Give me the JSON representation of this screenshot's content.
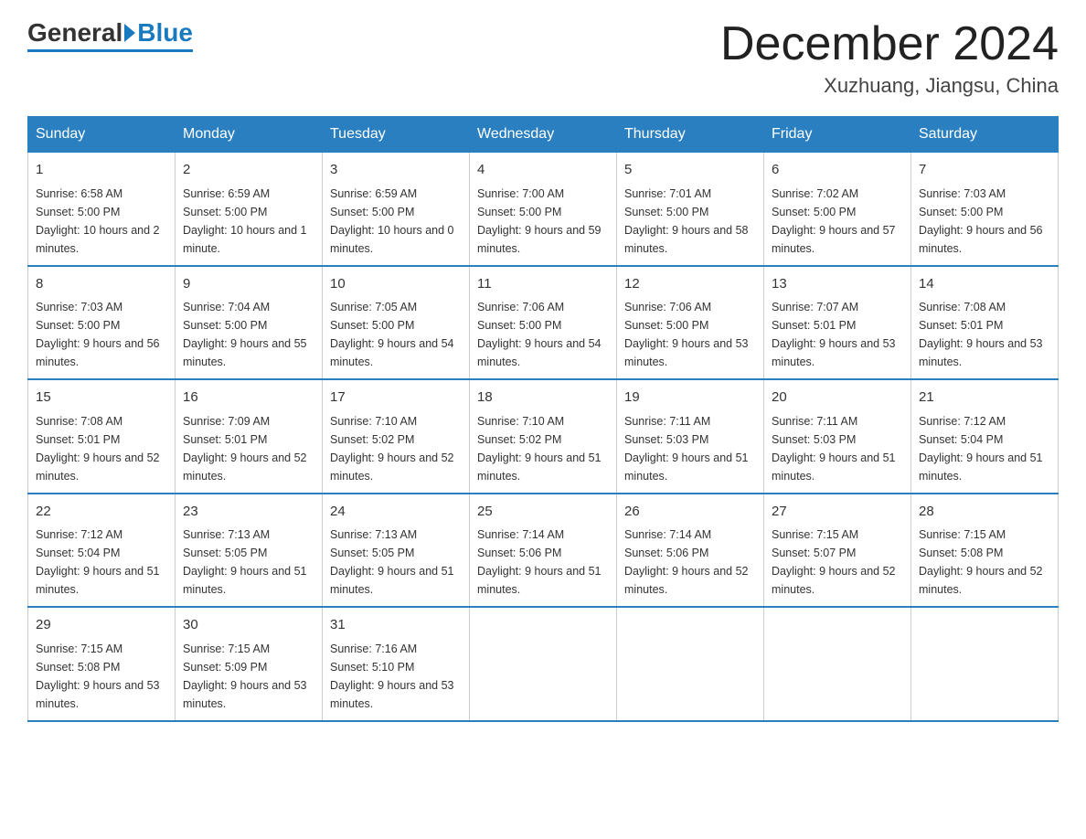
{
  "logo": {
    "general": "General",
    "blue": "Blue"
  },
  "header": {
    "month": "December 2024",
    "location": "Xuzhuang, Jiangsu, China"
  },
  "days_of_week": [
    "Sunday",
    "Monday",
    "Tuesday",
    "Wednesday",
    "Thursday",
    "Friday",
    "Saturday"
  ],
  "weeks": [
    [
      {
        "day": "1",
        "sunrise": "6:58 AM",
        "sunset": "5:00 PM",
        "daylight": "10 hours and 2 minutes."
      },
      {
        "day": "2",
        "sunrise": "6:59 AM",
        "sunset": "5:00 PM",
        "daylight": "10 hours and 1 minute."
      },
      {
        "day": "3",
        "sunrise": "6:59 AM",
        "sunset": "5:00 PM",
        "daylight": "10 hours and 0 minutes."
      },
      {
        "day": "4",
        "sunrise": "7:00 AM",
        "sunset": "5:00 PM",
        "daylight": "9 hours and 59 minutes."
      },
      {
        "day": "5",
        "sunrise": "7:01 AM",
        "sunset": "5:00 PM",
        "daylight": "9 hours and 58 minutes."
      },
      {
        "day": "6",
        "sunrise": "7:02 AM",
        "sunset": "5:00 PM",
        "daylight": "9 hours and 57 minutes."
      },
      {
        "day": "7",
        "sunrise": "7:03 AM",
        "sunset": "5:00 PM",
        "daylight": "9 hours and 56 minutes."
      }
    ],
    [
      {
        "day": "8",
        "sunrise": "7:03 AM",
        "sunset": "5:00 PM",
        "daylight": "9 hours and 56 minutes."
      },
      {
        "day": "9",
        "sunrise": "7:04 AM",
        "sunset": "5:00 PM",
        "daylight": "9 hours and 55 minutes."
      },
      {
        "day": "10",
        "sunrise": "7:05 AM",
        "sunset": "5:00 PM",
        "daylight": "9 hours and 54 minutes."
      },
      {
        "day": "11",
        "sunrise": "7:06 AM",
        "sunset": "5:00 PM",
        "daylight": "9 hours and 54 minutes."
      },
      {
        "day": "12",
        "sunrise": "7:06 AM",
        "sunset": "5:00 PM",
        "daylight": "9 hours and 53 minutes."
      },
      {
        "day": "13",
        "sunrise": "7:07 AM",
        "sunset": "5:01 PM",
        "daylight": "9 hours and 53 minutes."
      },
      {
        "day": "14",
        "sunrise": "7:08 AM",
        "sunset": "5:01 PM",
        "daylight": "9 hours and 53 minutes."
      }
    ],
    [
      {
        "day": "15",
        "sunrise": "7:08 AM",
        "sunset": "5:01 PM",
        "daylight": "9 hours and 52 minutes."
      },
      {
        "day": "16",
        "sunrise": "7:09 AM",
        "sunset": "5:01 PM",
        "daylight": "9 hours and 52 minutes."
      },
      {
        "day": "17",
        "sunrise": "7:10 AM",
        "sunset": "5:02 PM",
        "daylight": "9 hours and 52 minutes."
      },
      {
        "day": "18",
        "sunrise": "7:10 AM",
        "sunset": "5:02 PM",
        "daylight": "9 hours and 51 minutes."
      },
      {
        "day": "19",
        "sunrise": "7:11 AM",
        "sunset": "5:03 PM",
        "daylight": "9 hours and 51 minutes."
      },
      {
        "day": "20",
        "sunrise": "7:11 AM",
        "sunset": "5:03 PM",
        "daylight": "9 hours and 51 minutes."
      },
      {
        "day": "21",
        "sunrise": "7:12 AM",
        "sunset": "5:04 PM",
        "daylight": "9 hours and 51 minutes."
      }
    ],
    [
      {
        "day": "22",
        "sunrise": "7:12 AM",
        "sunset": "5:04 PM",
        "daylight": "9 hours and 51 minutes."
      },
      {
        "day": "23",
        "sunrise": "7:13 AM",
        "sunset": "5:05 PM",
        "daylight": "9 hours and 51 minutes."
      },
      {
        "day": "24",
        "sunrise": "7:13 AM",
        "sunset": "5:05 PM",
        "daylight": "9 hours and 51 minutes."
      },
      {
        "day": "25",
        "sunrise": "7:14 AM",
        "sunset": "5:06 PM",
        "daylight": "9 hours and 51 minutes."
      },
      {
        "day": "26",
        "sunrise": "7:14 AM",
        "sunset": "5:06 PM",
        "daylight": "9 hours and 52 minutes."
      },
      {
        "day": "27",
        "sunrise": "7:15 AM",
        "sunset": "5:07 PM",
        "daylight": "9 hours and 52 minutes."
      },
      {
        "day": "28",
        "sunrise": "7:15 AM",
        "sunset": "5:08 PM",
        "daylight": "9 hours and 52 minutes."
      }
    ],
    [
      {
        "day": "29",
        "sunrise": "7:15 AM",
        "sunset": "5:08 PM",
        "daylight": "9 hours and 53 minutes."
      },
      {
        "day": "30",
        "sunrise": "7:15 AM",
        "sunset": "5:09 PM",
        "daylight": "9 hours and 53 minutes."
      },
      {
        "day": "31",
        "sunrise": "7:16 AM",
        "sunset": "5:10 PM",
        "daylight": "9 hours and 53 minutes."
      },
      null,
      null,
      null,
      null
    ]
  ]
}
